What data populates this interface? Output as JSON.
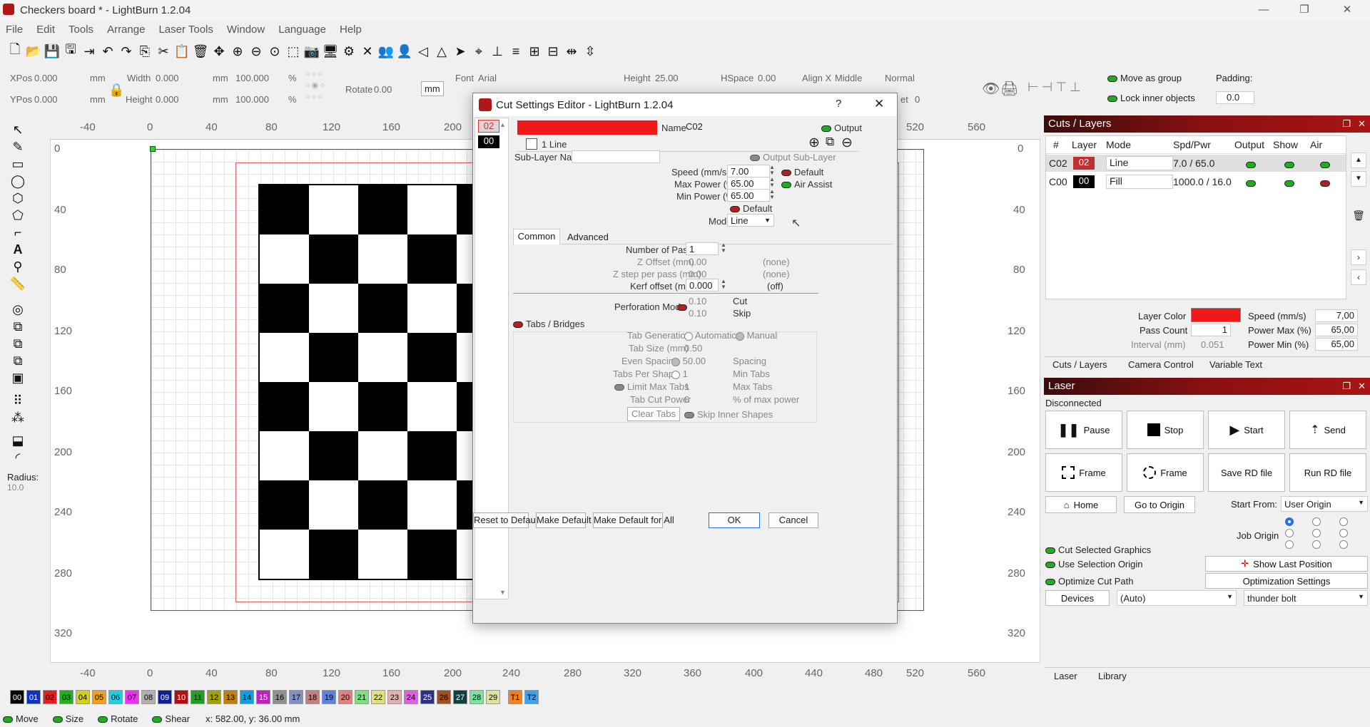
{
  "window": {
    "title": "Checkers board * - LightBurn 1.2.04",
    "min": "—",
    "max": "❐",
    "close": "✕"
  },
  "menu": [
    "File",
    "Edit",
    "Tools",
    "Arrange",
    "Laser Tools",
    "Window",
    "Language",
    "Help"
  ],
  "props": {
    "xpos_label": "XPos",
    "xpos": "0.000",
    "ypos_label": "YPos",
    "ypos": "0.000",
    "unit": "mm",
    "width_label": "Width",
    "width": "0.000",
    "height_label": "Height",
    "height": "0.000",
    "wpct": "100.000",
    "hpct": "100.000",
    "pct": "%",
    "rotate_label": "Rotate",
    "rotate": "0.00",
    "mm_btn": "mm",
    "font_label": "Font",
    "font": "Arial",
    "fheight_label": "Height",
    "fheight": "25.00",
    "hspace_label": "HSpace",
    "hspace": "0.00",
    "alignx_label": "Align X",
    "alignx": "Middle",
    "style": "Normal",
    "offset_label": "et",
    "offset": "0",
    "move_group": "Move as group",
    "lock_inner": "Lock inner objects",
    "padding_label": "Padding:",
    "padding": "0.0"
  },
  "ruler": {
    "top": [
      "-40",
      "0",
      "40",
      "80",
      "120",
      "160",
      "200",
      "240",
      "280",
      "320",
      "360",
      "400",
      "440",
      "480",
      "520",
      "560"
    ],
    "left": [
      "0",
      "40",
      "80",
      "120",
      "160",
      "200",
      "240",
      "280",
      "320"
    ],
    "bottom": [
      "-40",
      "0",
      "40",
      "80",
      "120",
      "160",
      "200",
      "240",
      "280",
      "320",
      "360",
      "400",
      "440",
      "480",
      "520",
      "560"
    ],
    "right": [
      "0",
      "40",
      "80",
      "120",
      "160",
      "200",
      "240",
      "280",
      "320"
    ]
  },
  "radius_label": "Radius:",
  "radius": "10.0",
  "dialog": {
    "title": "Cut Settings Editor - LightBurn 1.2.04",
    "help": "?",
    "close": "✕",
    "layers": [
      "02",
      "00"
    ],
    "name_label": "Name",
    "name": "C02",
    "output": "Output",
    "sublayer": "1 Line",
    "sublayer_name_label": "Sub-Layer Name",
    "output_sublayer": "Output Sub-Layer",
    "speed_label": "Speed (mm/sec)",
    "speed": "7.00",
    "default": "Default",
    "maxp_label": "Max Power (%)",
    "maxp": "65.00",
    "air_assist": "Air Assist",
    "minp_label": "Min Power (%)",
    "minp": "65.00",
    "default2": "Default",
    "mode_label": "Mode",
    "mode": "Line",
    "tabs": [
      "Common",
      "Advanced"
    ],
    "passes_label": "Number of Passes",
    "passes": "1",
    "zoff_label": "Z Offset (mm)",
    "zoff": "0.00",
    "zoff_note": "(none)",
    "zstep_label": "Z step per pass (mm)",
    "zstep": "0.00",
    "zstep_note": "(none)",
    "kerf_label": "Kerf offset (mm)",
    "kerf": "0.000",
    "kerf_note": "(off)",
    "perf_label": "Perforation Mode",
    "perf_cut": "0.10",
    "cut": "Cut",
    "perf_skip": "0.10",
    "skip": "Skip",
    "tabs_bridges": "Tabs / Bridges",
    "tabgen_label": "Tab Generation",
    "automatic": "Automatic",
    "manual": "Manual",
    "tabsize_label": "Tab Size (mm)",
    "tabsize": "0.50",
    "even_label": "Even Spacing",
    "even": "50.00",
    "spacing": "Spacing",
    "tps_label": "Tabs Per Shape",
    "tps": "1",
    "min_tabs": "Min Tabs",
    "limit_label": "Limit Max Tabs",
    "limit": "1",
    "max_tabs": "Max Tabs",
    "tcp_label": "Tab Cut Power",
    "tcp": "0",
    "tcp_note": "% of max power",
    "clear_tabs": "Clear Tabs",
    "skip_inner": "Skip Inner Shapes",
    "buttons": {
      "reset": "Reset to Default",
      "make_default": "Make Default",
      "make_default_all": "Make Default for All",
      "ok": "OK",
      "cancel": "Cancel"
    }
  },
  "cuts": {
    "title": "Cuts / Layers",
    "headers": [
      "#",
      "Layer",
      "Mode",
      "Spd/Pwr",
      "Output",
      "Show",
      "Air"
    ],
    "rows": [
      {
        "num": "C02",
        "layer": "02",
        "mode": "Line",
        "spdpwr": "7.0 / 65.0",
        "color": "#e03030"
      },
      {
        "num": "C00",
        "layer": "00",
        "mode": "Fill",
        "spdpwr": "1000.0 / 16.0",
        "color": "#000000"
      }
    ],
    "layer_color_label": "Layer Color",
    "speed_label": "Speed (mm/s)",
    "speed": "7,00",
    "pass_label": "Pass Count",
    "pass": "1",
    "pmax_label": "Power Max (%)",
    "pmax": "65,00",
    "interval_label": "Interval (mm)",
    "interval": "0.051",
    "pmin_label": "Power Min (%)",
    "pmin": "65,00",
    "tabs": [
      "Cuts / Layers",
      "Camera Control",
      "Variable Text"
    ]
  },
  "laser": {
    "title": "Laser",
    "status": "Disconnected",
    "pause": "Pause",
    "stop": "Stop",
    "start": "Start",
    "send": "Send",
    "frame1": "Frame",
    "frame2": "Frame",
    "save_rd": "Save RD file",
    "run_rd": "Run RD file",
    "home": "Home",
    "goto_origin": "Go to Origin",
    "start_from_label": "Start From:",
    "start_from": "User Origin",
    "job_origin": "Job Origin",
    "cut_selected": "Cut Selected Graphics",
    "use_selection": "Use Selection Origin",
    "optimize": "Optimize Cut Path",
    "show_last": "Show Last Position",
    "opt_settings": "Optimization Settings",
    "devices": "Devices",
    "port": "(Auto)",
    "device": "thunder bolt",
    "tabs": [
      "Laser",
      "Library"
    ]
  },
  "palette": [
    {
      "n": "00",
      "c": "#000000",
      "t": "#ffffff"
    },
    {
      "n": "01",
      "c": "#1030c0",
      "t": "#ffffff"
    },
    {
      "n": "02",
      "c": "#e02020",
      "t": "#000000"
    },
    {
      "n": "03",
      "c": "#20b020",
      "t": "#000000"
    },
    {
      "n": "04",
      "c": "#d0d020",
      "t": "#000000"
    },
    {
      "n": "05",
      "c": "#f0a020",
      "t": "#000000"
    },
    {
      "n": "06",
      "c": "#20d0e0",
      "t": "#000000"
    },
    {
      "n": "07",
      "c": "#f030f0",
      "t": "#000000"
    },
    {
      "n": "08",
      "c": "#b0b0b0",
      "t": "#000000"
    },
    {
      "n": "09",
      "c": "#102090",
      "t": "#ffffff"
    },
    {
      "n": "10",
      "c": "#b01010",
      "t": "#ffffff"
    },
    {
      "n": "11",
      "c": "#20a020",
      "t": "#000000"
    },
    {
      "n": "12",
      "c": "#a0a010",
      "t": "#000000"
    },
    {
      "n": "13",
      "c": "#c08010",
      "t": "#000000"
    },
    {
      "n": "14",
      "c": "#10a0e0",
      "t": "#000000"
    },
    {
      "n": "15",
      "c": "#c020c0",
      "t": "#ffffff"
    },
    {
      "n": "16",
      "c": "#909090",
      "t": "#000000"
    },
    {
      "n": "17",
      "c": "#8090c0",
      "t": "#000000"
    },
    {
      "n": "18",
      "c": "#c08080",
      "t": "#000000"
    },
    {
      "n": "19",
      "c": "#6080e0",
      "t": "#000000"
    },
    {
      "n": "20",
      "c": "#e08080",
      "t": "#000000"
    },
    {
      "n": "21",
      "c": "#80e080",
      "t": "#000000"
    },
    {
      "n": "22",
      "c": "#e0e080",
      "t": "#000000"
    },
    {
      "n": "23",
      "c": "#e0b0b0",
      "t": "#000000"
    },
    {
      "n": "24",
      "c": "#e060e0",
      "t": "#000000"
    },
    {
      "n": "25",
      "c": "#303080",
      "t": "#ffffff"
    },
    {
      "n": "26",
      "c": "#a05020",
      "t": "#000000"
    },
    {
      "n": "27",
      "c": "#104040",
      "t": "#ffffff"
    },
    {
      "n": "28",
      "c": "#80e0a0",
      "t": "#000000"
    },
    {
      "n": "29",
      "c": "#e0e0a0",
      "t": "#000000"
    },
    {
      "n": "T1",
      "c": "#f08020",
      "t": "#000000"
    },
    {
      "n": "T2",
      "c": "#40a0f0",
      "t": "#000000"
    }
  ],
  "status": {
    "move": "Move",
    "size": "Size",
    "rotate": "Rotate",
    "shear": "Shear",
    "coords": "x: 582.00, y: 36.00 mm"
  }
}
